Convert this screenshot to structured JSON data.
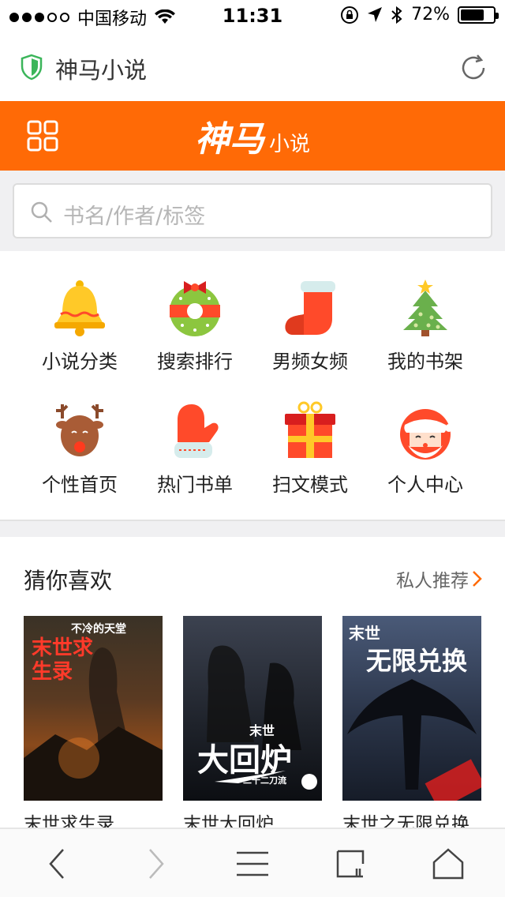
{
  "status_bar": {
    "carrier": "中国移动",
    "time": "11:31",
    "battery_percent": "72%",
    "battery_level": 0.72,
    "signal_bars_filled": 3
  },
  "browser": {
    "site_title": "神马小说"
  },
  "header": {
    "logo_main": "神马",
    "logo_sub": "小说",
    "bg_color": "#ff6a06"
  },
  "search": {
    "placeholder": "书名/作者/标签"
  },
  "categories": [
    {
      "label": "小说分类",
      "icon": "bell-icon"
    },
    {
      "label": "搜索排行",
      "icon": "wreath-icon"
    },
    {
      "label": "男频女频",
      "icon": "stocking-icon"
    },
    {
      "label": "我的书架",
      "icon": "christmas-tree-icon"
    },
    {
      "label": "个性首页",
      "icon": "reindeer-icon"
    },
    {
      "label": "热门书单",
      "icon": "mitten-icon"
    },
    {
      "label": "扫文模式",
      "icon": "gift-box-icon"
    },
    {
      "label": "个人中心",
      "icon": "santa-icon"
    }
  ],
  "recommend": {
    "title": "猜你喜欢",
    "more_label": "私人推荐",
    "books": [
      {
        "title": "末世求生录",
        "cover_text_top": "不冷的天堂",
        "cover_text_main": "末世求生录"
      },
      {
        "title": "末世大回炉",
        "cover_text_top": "末世",
        "cover_text_main": "大回炉",
        "cover_author": "二十二刀流"
      },
      {
        "title": "末世之无限兑换",
        "cover_text_top": "末世",
        "cover_text_main": "无限兑换"
      }
    ]
  },
  "toolbar": {
    "icons": [
      "back-icon",
      "forward-icon",
      "menu-icon",
      "tabs-icon",
      "home-icon"
    ]
  }
}
